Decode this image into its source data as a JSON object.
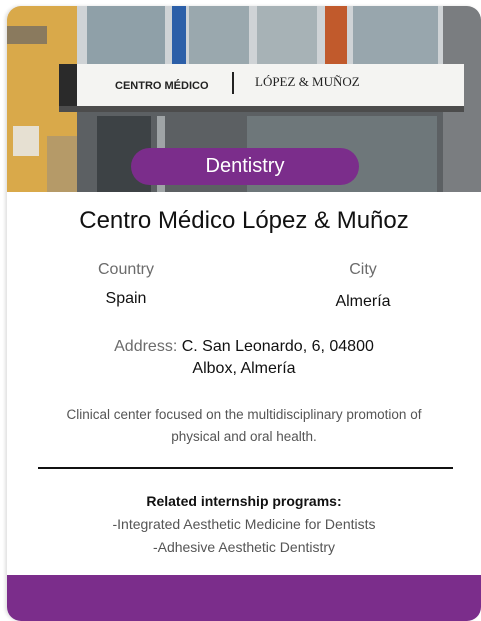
{
  "card": {
    "photo": {
      "sign_left": "CENTRO MÉDICO",
      "sign_right": "LÓPEZ & MUÑOZ"
    },
    "category_tag": "Dentistry",
    "title": "Centro Médico López & Muñoz",
    "country_label": "Country",
    "country_value": "Spain",
    "city_label": "City",
    "city_value": "Almería",
    "address_label": "Address:",
    "address_line1": "C. San Leonardo, 6, 04800",
    "address_line2": "Albox, Almería",
    "description": "Clinical center focused on the multidisciplinary promotion of physical and oral health.",
    "programs_heading": "Related internship programs:",
    "programs": [
      "-Integrated Aesthetic Medicine for Dentists",
      "-Adhesive Aesthetic Dentistry"
    ]
  },
  "colors": {
    "accent": "#7b2d8b"
  }
}
